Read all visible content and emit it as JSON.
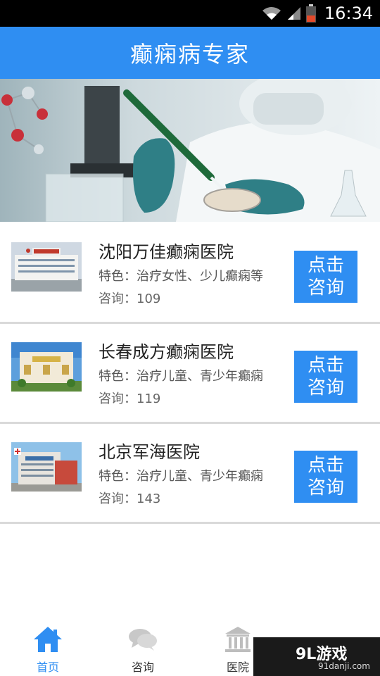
{
  "status_bar": {
    "time": "16:34"
  },
  "header": {
    "title": "癫痫病专家"
  },
  "hospitals": [
    {
      "name": "沈阳万佳癫痫医院",
      "feature": "特色：治疗女性、少儿癫痫等",
      "consult": "咨询：109",
      "button": "点击咨询"
    },
    {
      "name": "长春成方癫痫医院",
      "feature": "特色：治疗儿童、青少年癫痫",
      "consult": "咨询：119",
      "button": "点击咨询"
    },
    {
      "name": "北京军海医院",
      "feature": "特色：治疗儿童、青少年癫痫",
      "consult": "咨询：143",
      "button": "点击咨询"
    }
  ],
  "bottom_nav": {
    "items": [
      {
        "label": "首页",
        "icon": "home-icon",
        "active": true
      },
      {
        "label": "咨询",
        "icon": "chat-icon",
        "active": false
      },
      {
        "label": "医院",
        "icon": "hospital-icon",
        "active": false
      }
    ]
  },
  "watermark": {
    "logo": "9L游戏",
    "url": "91danji.com"
  },
  "colors": {
    "accent": "#2f8ef2",
    "status_bar": "#000000"
  }
}
